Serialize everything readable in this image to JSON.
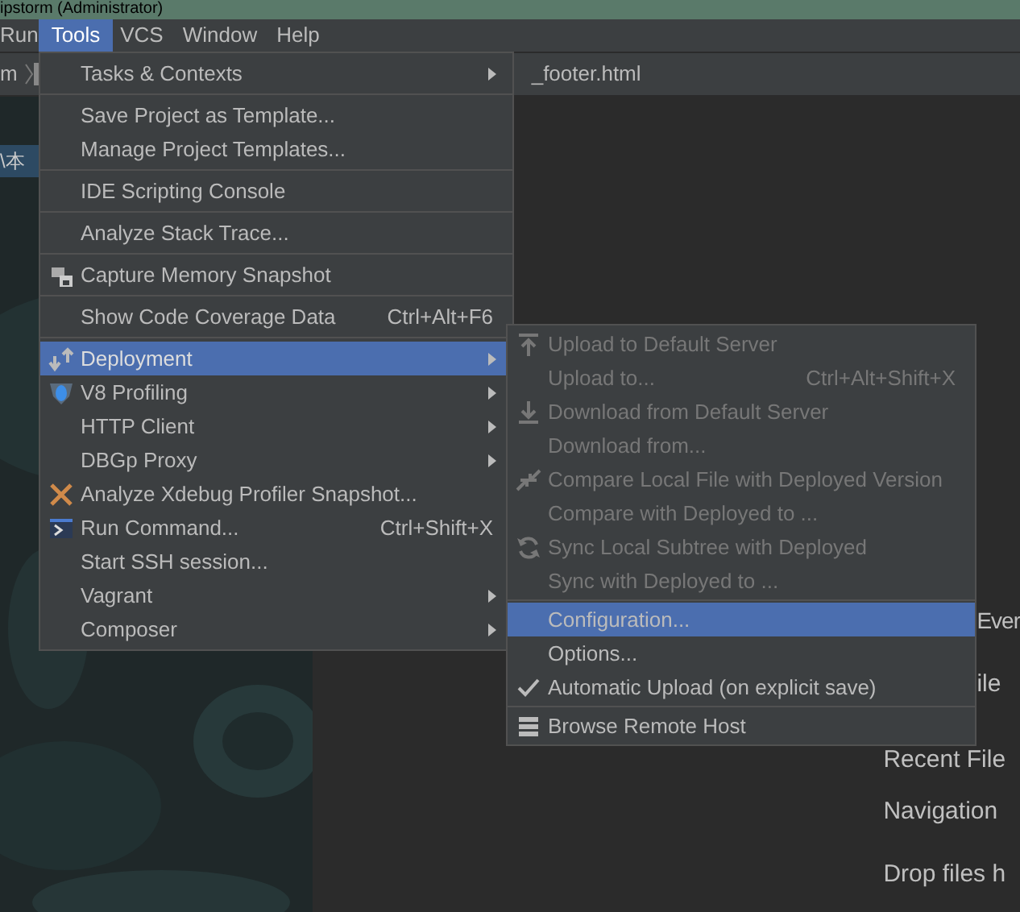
{
  "window": {
    "title": "ipstorm (Administrator)"
  },
  "menu_bar": [
    {
      "label": "Run",
      "selected": false
    },
    {
      "label": "Tools",
      "selected": true
    },
    {
      "label": "VCS",
      "selected": false
    },
    {
      "label": "Window",
      "selected": false
    },
    {
      "label": "Help",
      "selected": false
    }
  ],
  "breadcrumbs": [
    {
      "label": "m"
    },
    {
      "label": "_footer.html"
    }
  ],
  "project_panel": {
    "path_text": "\\本"
  },
  "tools_menu": {
    "groups": [
      [
        {
          "label": "Tasks & Contexts",
          "submenu": true,
          "selected": false
        }
      ],
      [
        {
          "label": "Save Project as Template...",
          "submenu": false,
          "selected": false
        },
        {
          "label": "Manage Project Templates...",
          "submenu": false,
          "selected": false
        }
      ],
      [
        {
          "label": "IDE Scripting Console",
          "submenu": false,
          "selected": false
        }
      ],
      [
        {
          "label": "Analyze Stack Trace...",
          "submenu": false,
          "selected": false
        }
      ],
      [
        {
          "label": "Capture Memory Snapshot",
          "submenu": false,
          "selected": false
        }
      ],
      [
        {
          "label": "Show Code Coverage Data",
          "shortcut": "Ctrl+Alt+F6",
          "submenu": false,
          "selected": false
        }
      ],
      [
        {
          "label": "Deployment",
          "submenu": true,
          "selected": true
        },
        {
          "label": "V8 Profiling",
          "submenu": true,
          "selected": false
        },
        {
          "label": "HTTP Client",
          "submenu": true,
          "selected": false
        },
        {
          "label": "DBGp Proxy",
          "submenu": true,
          "selected": false
        },
        {
          "label": "Analyze Xdebug Profiler Snapshot...",
          "submenu": false,
          "selected": false
        },
        {
          "label": "Run Command...",
          "shortcut": "Ctrl+Shift+X",
          "submenu": false,
          "selected": false
        },
        {
          "label": "Start SSH session...",
          "submenu": false,
          "selected": false
        },
        {
          "label": "Vagrant",
          "submenu": true,
          "selected": false
        },
        {
          "label": "Composer",
          "submenu": true,
          "selected": false
        }
      ]
    ]
  },
  "deployment_submenu": {
    "groups": [
      [
        {
          "label": "Upload to Default Server",
          "disabled": true,
          "checked": false,
          "selected": false
        },
        {
          "label": "Upload to...",
          "shortcut": "Ctrl+Alt+Shift+X",
          "disabled": true,
          "checked": false,
          "selected": false
        },
        {
          "label": "Download from Default Server",
          "disabled": true,
          "checked": false,
          "selected": false
        },
        {
          "label": "Download from...",
          "disabled": true,
          "checked": false,
          "selected": false
        },
        {
          "label": "Compare Local File with Deployed Version",
          "disabled": true,
          "checked": false,
          "selected": false
        },
        {
          "label": "Compare with Deployed to ...",
          "disabled": true,
          "checked": false,
          "selected": false
        },
        {
          "label": "Sync Local Subtree with Deployed",
          "disabled": true,
          "checked": false,
          "selected": false
        },
        {
          "label": "Sync with Deployed to ...",
          "disabled": true,
          "checked": false,
          "selected": false
        }
      ],
      [
        {
          "label": "Configuration...",
          "disabled": false,
          "checked": false,
          "selected": true
        },
        {
          "label": "Options...",
          "disabled": false,
          "checked": false,
          "selected": false
        },
        {
          "label": "Automatic Upload (on explicit save)",
          "disabled": false,
          "checked": true,
          "selected": false
        }
      ],
      [
        {
          "label": "Browse Remote Host",
          "disabled": false,
          "checked": false,
          "selected": false
        }
      ]
    ]
  },
  "editor_hints": [
    "Ever",
    "ile",
    "Recent File",
    "Navigation",
    "Drop files h"
  ]
}
